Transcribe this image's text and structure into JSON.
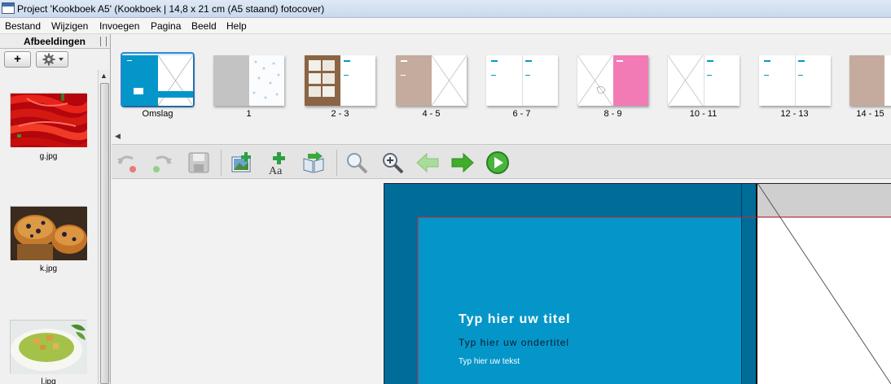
{
  "window": {
    "title": "Project 'Kookboek A5' (Kookboek | 14,8 x 21 cm (A5 staand) fotocover)"
  },
  "menu": {
    "items": [
      "Bestand",
      "Wijzigen",
      "Invoegen",
      "Pagina",
      "Beeld",
      "Help"
    ]
  },
  "left_panel": {
    "header": "Afbeeldingen",
    "add_label": "+",
    "images": [
      {
        "label": "g.jpg",
        "icon": "image-thumbnail-peppers"
      },
      {
        "label": "k.jpg",
        "icon": "image-thumbnail-muffins"
      },
      {
        "label": "l.jpg",
        "icon": "image-thumbnail-soup"
      }
    ]
  },
  "page_strip": {
    "pages": [
      {
        "label": "Omslag",
        "selected": true
      },
      {
        "label": "1"
      },
      {
        "label": "2 - 3"
      },
      {
        "label": "4 - 5"
      },
      {
        "label": "6 - 7"
      },
      {
        "label": "8 - 9"
      },
      {
        "label": "10 - 11"
      },
      {
        "label": "12 - 13"
      },
      {
        "label": "14 - 15"
      }
    ]
  },
  "toolbar": {
    "icons": [
      "undo-icon",
      "redo-icon",
      "save-icon",
      "insert-image-icon",
      "insert-text-icon",
      "insert-page-icon",
      "zoom-out-icon",
      "zoom-in-icon",
      "previous-page-icon",
      "next-page-icon",
      "preview-play-icon"
    ]
  },
  "cover": {
    "title": "Typ hier uw titel",
    "subtitle": "Typ hier uw ondertitel",
    "body": "Typ hier uw tekst"
  },
  "colors": {
    "cover_dark": "#006d99",
    "cover_front": "#0596c9",
    "bleed_line": "#cc2233",
    "pink_page": "#f27bb6",
    "kraft_page": "#c4ab9e"
  }
}
